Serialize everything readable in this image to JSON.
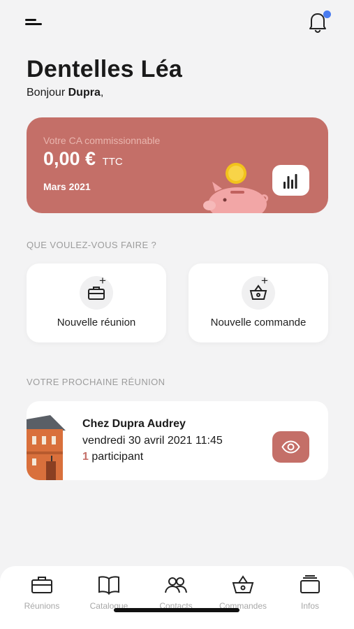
{
  "header": {
    "menu_icon": "menu-icon",
    "bell_icon": "bell-icon",
    "notification_dot_color": "#4a7cf0"
  },
  "brand": "Dentelles Léa",
  "greeting": {
    "prefix": "Bonjour",
    "name": "Dupra",
    "suffix": ","
  },
  "ca_card": {
    "label": "Votre CA commissionnable",
    "amount": "0,00 €",
    "unit": "TTC",
    "period": "Mars 2021",
    "background_color": "#c46f68",
    "stats_icon": "bar-chart-icon"
  },
  "actions": {
    "title": "QUE VOULEZ-VOUS FAIRE ?",
    "items": [
      {
        "label": "Nouvelle réunion",
        "icon": "briefcase-plus-icon"
      },
      {
        "label": "Nouvelle commande",
        "icon": "basket-plus-icon"
      }
    ]
  },
  "next_meeting": {
    "section_title": "VOTRE PROCHAINE RÉUNION",
    "title": "Chez Dupra Audrey",
    "date": "vendredi 30 avril 2021 11:45",
    "participant_count": "1",
    "participant_label": "participant",
    "view_icon": "eye-icon"
  },
  "tabbar": {
    "items": [
      {
        "label": "Réunions",
        "icon": "briefcase-icon"
      },
      {
        "label": "Catalogue",
        "icon": "book-icon"
      },
      {
        "label": "Contacts",
        "icon": "contacts-icon"
      },
      {
        "label": "Commandes",
        "icon": "basket-icon"
      },
      {
        "label": "Infos",
        "icon": "layers-icon"
      }
    ]
  }
}
